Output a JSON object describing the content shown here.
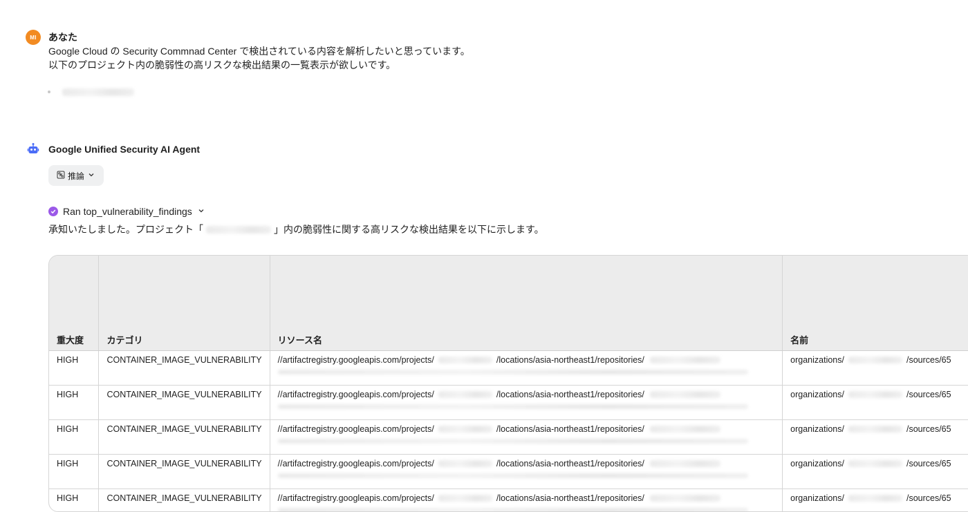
{
  "user_message": {
    "avatar_initials": "MI",
    "sender": "あなた",
    "lines": [
      "Google Cloud の Security Commnad Center で検出されている内容を解析したいと思っています。",
      "以下のプロジェクト内の脆弱性の高リスクな検出結果の一覧表示が欲しいです。"
    ]
  },
  "agent_message": {
    "sender": "Google Unified Security AI Agent",
    "reasoning_label": "推論",
    "tool_run_label": "Ran top_vulnerability_findings",
    "response_prefix": "承知いたしました。プロジェクト「",
    "response_suffix": "」内の脆弱性に関する高リスクな検出結果を以下に示します。"
  },
  "table": {
    "headers": [
      "重大度",
      "カテゴリ",
      "リソース名",
      "名前"
    ],
    "resource_prefix": "//artifactregistry.googleapis.com/projects/",
    "resource_middle": "/locations/asia-northeast1/repositories/",
    "name_prefix": "organizations/",
    "name_suffix": "/sources/65",
    "rows": [
      {
        "severity": "HIGH",
        "category": "CONTAINER_IMAGE_VULNERABILITY"
      },
      {
        "severity": "HIGH",
        "category": "CONTAINER_IMAGE_VULNERABILITY"
      },
      {
        "severity": "HIGH",
        "category": "CONTAINER_IMAGE_VULNERABILITY"
      },
      {
        "severity": "HIGH",
        "category": "CONTAINER_IMAGE_VULNERABILITY"
      },
      {
        "severity": "HIGH",
        "category": "CONTAINER_IMAGE_VULNERABILITY"
      }
    ]
  },
  "colors": {
    "user_avatar": "#f28b22",
    "bot_icon": "#4a6cf7",
    "check_icon": "#9b59e8",
    "table_header_bg": "#ececec"
  },
  "icons": [
    "bot-icon",
    "reasoning-icon",
    "chevron-down-icon",
    "check-circle-icon"
  ]
}
